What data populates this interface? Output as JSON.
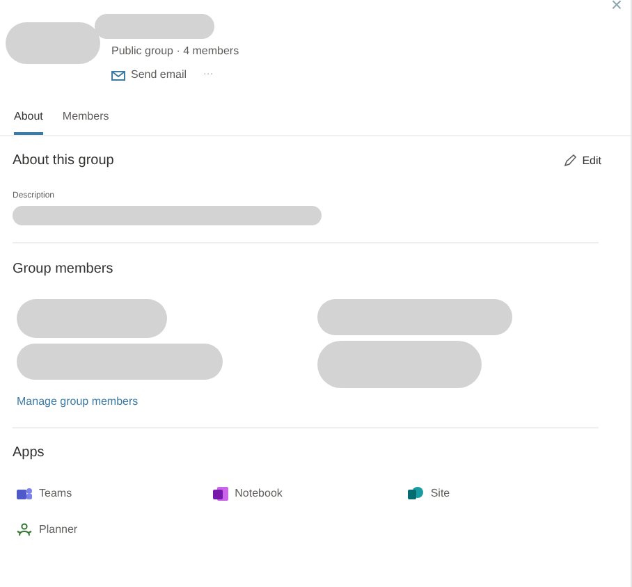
{
  "header": {
    "subtitle": "Public group · 4 members",
    "send_email": "Send email",
    "more": "···",
    "close": "×"
  },
  "tabs": [
    {
      "label": "About",
      "selected": true
    },
    {
      "label": "Members",
      "selected": false
    }
  ],
  "about": {
    "title": "About this group",
    "edit": "Edit",
    "description_label": "Description"
  },
  "members": {
    "title": "Group members",
    "manage_link": "Manage group members"
  },
  "apps": {
    "title": "Apps",
    "items": [
      {
        "kind": "teams",
        "label": "Teams"
      },
      {
        "kind": "notebook",
        "label": "Notebook"
      },
      {
        "kind": "site",
        "label": "Site"
      },
      {
        "kind": "planner",
        "label": "Planner"
      }
    ]
  }
}
